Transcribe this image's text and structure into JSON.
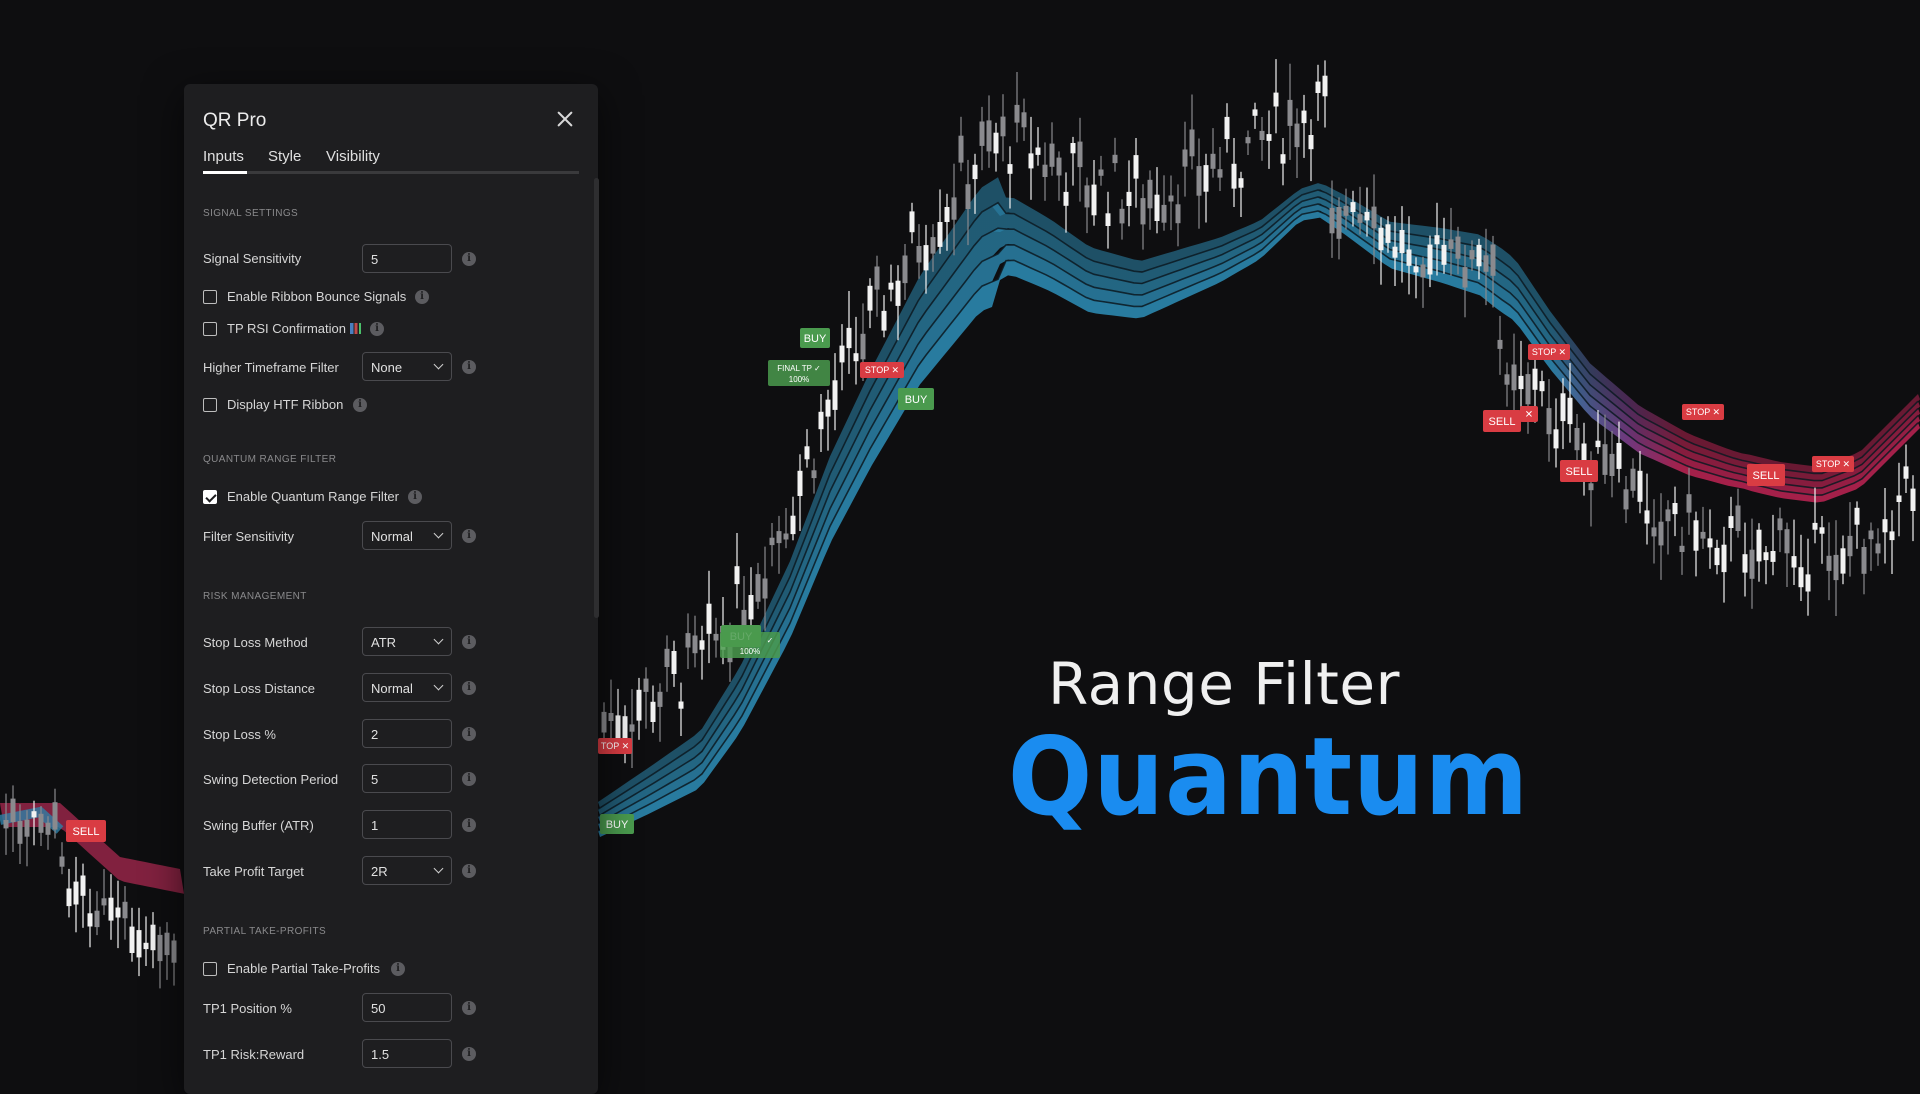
{
  "dialog": {
    "title": "QR Pro",
    "tabs": [
      "Inputs",
      "Style",
      "Visibility"
    ],
    "active_tab": "Inputs",
    "sections": {
      "signal": "SIGNAL SETTINGS",
      "quantum": "QUANTUM RANGE FILTER",
      "risk": "RISK MANAGEMENT",
      "partial": "PARTIAL TAKE-PROFITS"
    },
    "fields": {
      "signal_sensitivity": {
        "label": "Signal Sensitivity",
        "value": "5"
      },
      "ribbon_bounce": {
        "label": "Enable Ribbon Bounce Signals",
        "checked": false
      },
      "tp_rsi": {
        "label": "TP RSI Confirmation",
        "checked": false
      },
      "htf_filter": {
        "label": "Higher Timeframe Filter",
        "value": "None"
      },
      "htf_ribbon": {
        "label": "Display HTF Ribbon",
        "checked": false
      },
      "enable_qrf": {
        "label": "Enable Quantum Range Filter",
        "checked": true
      },
      "filter_sensitivity": {
        "label": "Filter Sensitivity",
        "value": "Normal"
      },
      "sl_method": {
        "label": "Stop Loss Method",
        "value": "ATR"
      },
      "sl_distance": {
        "label": "Stop Loss Distance",
        "value": "Normal"
      },
      "sl_pct": {
        "label": "Stop Loss %",
        "value": "2"
      },
      "swing_period": {
        "label": "Swing Detection Period",
        "value": "5"
      },
      "swing_buffer": {
        "label": "Swing Buffer (ATR)",
        "value": "1"
      },
      "tp_target": {
        "label": "Take Profit Target",
        "value": "2R"
      },
      "partial_tp": {
        "label": "Enable Partial Take-Profits",
        "checked": false
      },
      "tp1_position": {
        "label": "TP1 Position %",
        "value": "50"
      },
      "tp1_rr": {
        "label": "TP1 Risk:Reward",
        "value": "1.5"
      }
    },
    "info_glyph": "i"
  },
  "headline": {
    "line1": "Range Filter",
    "line2": "Quantum"
  },
  "chart_markers": {
    "buy": "BUY",
    "sell": "SELL",
    "stop": "STOP ✕",
    "stop_cut": "TOP ✕",
    "final_tp": "FINAL TP ✓",
    "final_tp_pct": "100%",
    "tp_cut": "✓",
    "colors": {
      "bull_band": "#2e7fa6",
      "bear_band": "#a8284f",
      "buy_tag": "#4a9a4e",
      "sell_tag": "#d93c43",
      "headline_blue": "#1a8cf0"
    }
  }
}
